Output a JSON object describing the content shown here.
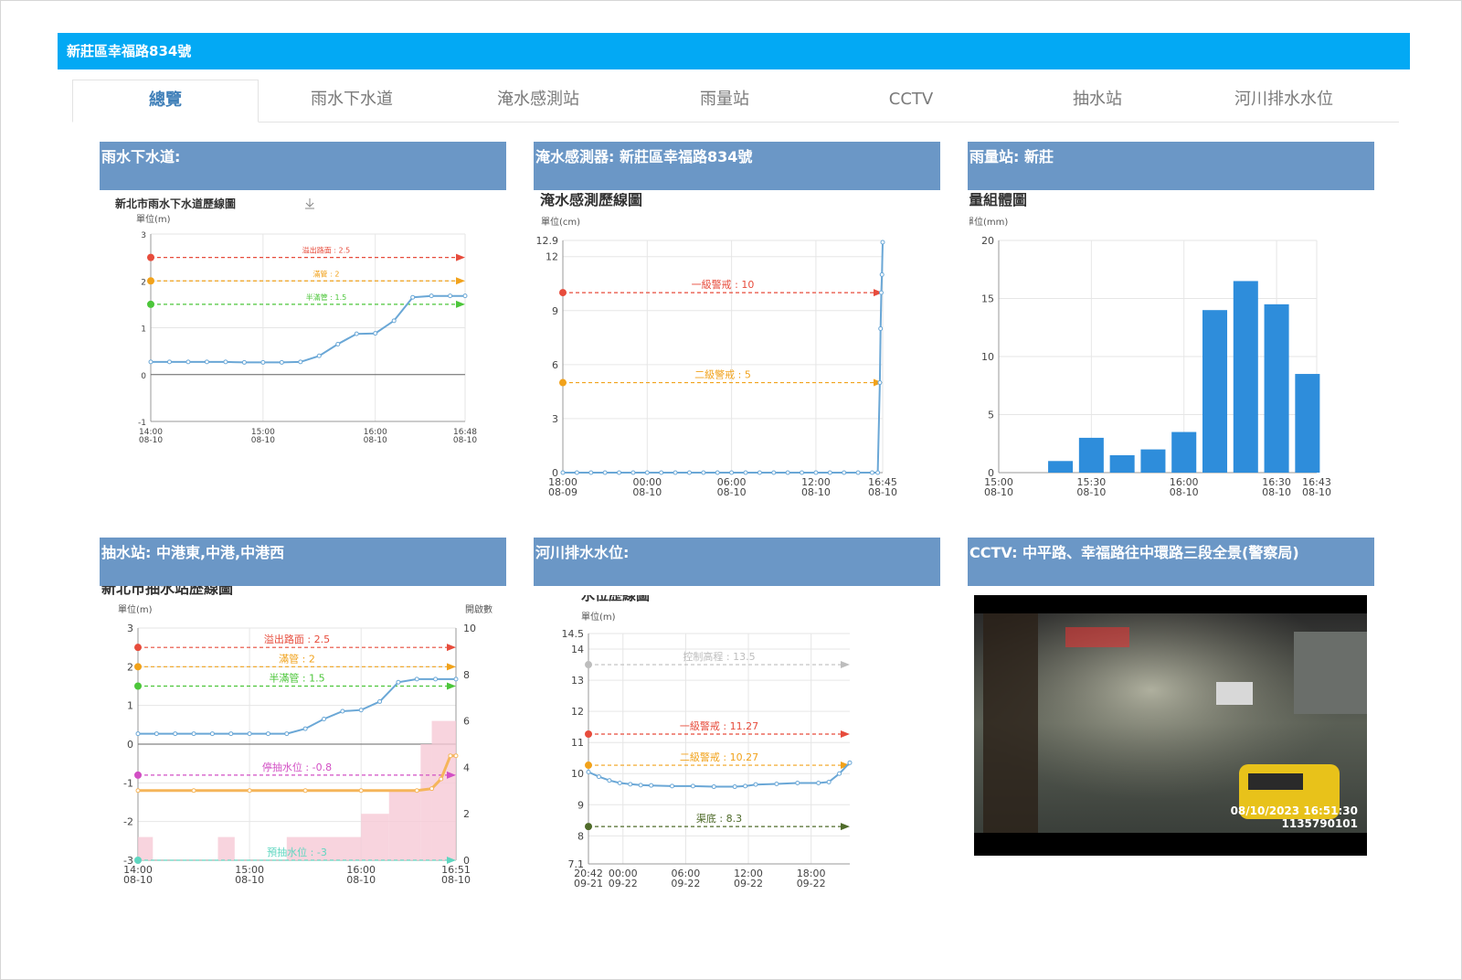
{
  "window_title": "新莊區幸福路834號",
  "tabs": [
    {
      "label": "總覽",
      "active": true
    },
    {
      "label": "雨水下水道"
    },
    {
      "label": "淹水感測站"
    },
    {
      "label": "雨量站"
    },
    {
      "label": "CCTV"
    },
    {
      "label": "抽水站"
    },
    {
      "label": "河川排水水位"
    }
  ],
  "panels": {
    "sewer": {
      "header": "雨水下水道:"
    },
    "flood": {
      "header": "淹水感測器: 新莊區幸福路834號"
    },
    "rain": {
      "header": "雨量站: 新莊"
    },
    "pump": {
      "header": "抽水站: 中港東,中港,中港西"
    },
    "river": {
      "header": "河川排水水位:"
    },
    "cctv": {
      "header": "CCTV: 中平路、幸福路往中環路三段全景(警察局)",
      "overlay_date": "08/10/2023 16:51:30",
      "overlay_id": "1135790101"
    }
  },
  "colors": {
    "accent": "#03a9f4",
    "panel_header": "#6b97c6",
    "line": "#6aa7d6",
    "bar": "#2e8ddb",
    "red": "#e74c3c",
    "orange": "#f1a21b",
    "green": "#4cc63a",
    "magenta": "#d24fc4",
    "teal": "#5fd6c0",
    "gray": "#bdbdbd",
    "olive": "#4f6b2a"
  },
  "chart_data": [
    {
      "id": "sewer",
      "type": "line",
      "title": "新北市雨水下水道歷線圖",
      "unit": "單位(m)",
      "download_icon": "download-icon",
      "ylim": [
        -1,
        3
      ],
      "yticks": [
        -1,
        0,
        1,
        2,
        3
      ],
      "xticks": [
        {
          "t": 0,
          "label": [
            "14:00",
            "08-10"
          ]
        },
        {
          "t": 60,
          "label": [
            "15:00",
            "08-10"
          ]
        },
        {
          "t": 120,
          "label": [
            "16:00",
            "08-10"
          ]
        },
        {
          "t": 168,
          "label": [
            "16:48",
            "08-10"
          ]
        }
      ],
      "x_range": [
        0,
        168
      ],
      "thresholds": [
        {
          "label": "溢出路面 : 2.5",
          "value": 2.5,
          "color": "#e74c3c"
        },
        {
          "label": "滿管 : 2",
          "value": 2,
          "color": "#f1a21b"
        },
        {
          "label": "半滿管 : 1.5",
          "value": 1.5,
          "color": "#4cc63a"
        }
      ],
      "series": [
        {
          "points": [
            [
              0,
              0.27
            ],
            [
              10,
              0.27
            ],
            [
              20,
              0.27
            ],
            [
              30,
              0.27
            ],
            [
              40,
              0.27
            ],
            [
              50,
              0.26
            ],
            [
              60,
              0.26
            ],
            [
              70,
              0.26
            ],
            [
              80,
              0.27
            ],
            [
              90,
              0.4
            ],
            [
              100,
              0.65
            ],
            [
              110,
              0.87
            ],
            [
              120,
              0.88
            ],
            [
              130,
              1.15
            ],
            [
              140,
              1.65
            ],
            [
              150,
              1.68
            ],
            [
              160,
              1.68
            ],
            [
              168,
              1.68
            ]
          ]
        }
      ]
    },
    {
      "id": "flood",
      "type": "line",
      "title": "淹水感測歷線圖",
      "unit": "單位(cm)",
      "ylim": [
        0,
        12.9
      ],
      "yticks": [
        0,
        3,
        6,
        9,
        12,
        12.9
      ],
      "xticks": [
        {
          "t": 0,
          "label": [
            "18:00",
            "08-09"
          ]
        },
        {
          "t": 6,
          "label": [
            "00:00",
            "08-10"
          ]
        },
        {
          "t": 12,
          "label": [
            "06:00",
            "08-10"
          ]
        },
        {
          "t": 18,
          "label": [
            "12:00",
            "08-10"
          ]
        },
        {
          "t": 22.75,
          "label": [
            "16:45",
            "08-10"
          ]
        }
      ],
      "x_range": [
        0,
        22.75
      ],
      "thresholds": [
        {
          "label": "一級警戒 : 10",
          "value": 10,
          "color": "#e74c3c"
        },
        {
          "label": "二級警戒 : 5",
          "value": 5,
          "color": "#f1a21b"
        }
      ],
      "series": [
        {
          "points": [
            [
              0,
              0
            ],
            [
              1,
              0
            ],
            [
              2,
              0
            ],
            [
              3,
              0
            ],
            [
              4,
              0
            ],
            [
              5,
              0
            ],
            [
              6,
              0
            ],
            [
              7,
              0
            ],
            [
              8,
              0
            ],
            [
              9,
              0
            ],
            [
              10,
              0
            ],
            [
              11,
              0
            ],
            [
              12,
              0
            ],
            [
              13,
              0
            ],
            [
              14,
              0
            ],
            [
              15,
              0
            ],
            [
              16,
              0
            ],
            [
              17,
              0
            ],
            [
              18,
              0
            ],
            [
              19,
              0
            ],
            [
              20,
              0
            ],
            [
              21,
              0
            ],
            [
              22,
              0
            ],
            [
              22.4,
              0
            ],
            [
              22.55,
              5
            ],
            [
              22.6,
              8
            ],
            [
              22.65,
              10
            ],
            [
              22.7,
              11
            ],
            [
              22.75,
              12.8
            ]
          ]
        }
      ]
    },
    {
      "id": "rain",
      "type": "bar",
      "title": "雨量組體圖",
      "unit": "單位(mm)",
      "ylim": [
        0,
        20
      ],
      "yticks": [
        0,
        5,
        10,
        15,
        20
      ],
      "xticks": [
        {
          "t": 0,
          "label": [
            "15:00",
            "08-10"
          ]
        },
        {
          "t": 30,
          "label": [
            "15:30",
            "08-10"
          ]
        },
        {
          "t": 60,
          "label": [
            "16:00",
            "08-10"
          ]
        },
        {
          "t": 90,
          "label": [
            "16:30",
            "08-10"
          ]
        },
        {
          "t": 103,
          "label": [
            "16:43",
            "08-10"
          ]
        }
      ],
      "x_range": [
        0,
        103
      ],
      "bars": [
        {
          "t": 20,
          "value": 1
        },
        {
          "t": 30,
          "value": 3
        },
        {
          "t": 40,
          "value": 1.5
        },
        {
          "t": 50,
          "value": 2
        },
        {
          "t": 60,
          "value": 3.5
        },
        {
          "t": 70,
          "value": 14
        },
        {
          "t": 80,
          "value": 16.5
        },
        {
          "t": 90,
          "value": 14.5
        },
        {
          "t": 100,
          "value": 8.5
        }
      ]
    },
    {
      "id": "pump",
      "type": "line",
      "title": "新北市抽水站歷線圖",
      "unit": "單位(m)",
      "unit_right": "開啟數",
      "ylim": [
        -3,
        3
      ],
      "yticks": [
        -3,
        -2,
        -1,
        0,
        1,
        2,
        3
      ],
      "y2lim": [
        0,
        10
      ],
      "y2ticks": [
        0,
        2,
        4,
        6,
        8,
        10
      ],
      "xticks": [
        {
          "t": 0,
          "label": [
            "14:00",
            "08-10"
          ]
        },
        {
          "t": 60,
          "label": [
            "15:00",
            "08-10"
          ]
        },
        {
          "t": 120,
          "label": [
            "16:00",
            "08-10"
          ]
        },
        {
          "t": 171,
          "label": [
            "16:51",
            "08-10"
          ]
        }
      ],
      "x_range": [
        0,
        171
      ],
      "thresholds": [
        {
          "label": "溢出路面 : 2.5",
          "value": 2.5,
          "color": "#e74c3c"
        },
        {
          "label": "滿管 : 2",
          "value": 2,
          "color": "#f1a21b"
        },
        {
          "label": "半滿管 : 1.5",
          "value": 1.5,
          "color": "#4cc63a"
        },
        {
          "label": "停抽水位 : -0.8",
          "value": -0.8,
          "color": "#d24fc4"
        },
        {
          "label": "預抽水位 : -3",
          "value": -3,
          "color": "#5fd6c0"
        }
      ],
      "series": [
        {
          "points": [
            [
              0,
              0.27
            ],
            [
              10,
              0.27
            ],
            [
              20,
              0.27
            ],
            [
              30,
              0.27
            ],
            [
              40,
              0.27
            ],
            [
              50,
              0.27
            ],
            [
              60,
              0.27
            ],
            [
              70,
              0.27
            ],
            [
              80,
              0.27
            ],
            [
              90,
              0.4
            ],
            [
              100,
              0.65
            ],
            [
              110,
              0.85
            ],
            [
              120,
              0.88
            ],
            [
              130,
              1.1
            ],
            [
              140,
              1.6
            ],
            [
              150,
              1.68
            ],
            [
              160,
              1.68
            ],
            [
              171,
              1.68
            ]
          ]
        },
        {
          "points": [
            [
              0,
              -1.2
            ],
            [
              30,
              -1.2
            ],
            [
              60,
              -1.2
            ],
            [
              90,
              -1.2
            ],
            [
              120,
              -1.2
            ],
            [
              150,
              -1.2
            ],
            [
              158,
              -1.15
            ],
            [
              163,
              -0.9
            ],
            [
              168,
              -0.3
            ],
            [
              171,
              -0.3
            ]
          ]
        }
      ],
      "open_counts": [
        {
          "t0": 0,
          "t1": 8,
          "value": 1
        },
        {
          "t0": 43,
          "t1": 52,
          "value": 1
        },
        {
          "t0": 80,
          "t1": 120,
          "value": 1
        },
        {
          "t0": 120,
          "t1": 135,
          "value": 2
        },
        {
          "t0": 135,
          "t1": 152,
          "value": 3
        },
        {
          "t0": 152,
          "t1": 158,
          "value": 5
        },
        {
          "t0": 158,
          "t1": 171,
          "value": 6
        }
      ]
    },
    {
      "id": "river",
      "type": "line",
      "title": "水位歷線圖",
      "unit": "單位(m)",
      "ylim": [
        7.1,
        14.5
      ],
      "yticks": [
        7.1,
        8,
        9,
        10,
        11,
        12,
        13,
        14,
        14.5
      ],
      "xticks": [
        {
          "t": 0,
          "label": [
            "20:42",
            "09-21"
          ]
        },
        {
          "t": 3.3,
          "label": [
            "00:00",
            "09-22"
          ]
        },
        {
          "t": 9.3,
          "label": [
            "06:00",
            "09-22"
          ]
        },
        {
          "t": 15.3,
          "label": [
            "12:00",
            "09-22"
          ]
        },
        {
          "t": 21.3,
          "label": [
            "18:00",
            "09-22"
          ]
        }
      ],
      "x_range": [
        0,
        25
      ],
      "thresholds": [
        {
          "label": "控制高程 : 13.5",
          "value": 13.5,
          "color": "#bdbdbd"
        },
        {
          "label": "一級警戒 : 11.27",
          "value": 11.27,
          "color": "#e74c3c"
        },
        {
          "label": "二級警戒 : 10.27",
          "value": 10.27,
          "color": "#f1a21b"
        },
        {
          "label": "渠底 : 8.3",
          "value": 8.3,
          "color": "#4f6b2a"
        }
      ],
      "series": [
        {
          "points": [
            [
              0,
              10.05
            ],
            [
              1,
              9.9
            ],
            [
              2,
              9.78
            ],
            [
              3,
              9.7
            ],
            [
              4,
              9.66
            ],
            [
              5,
              9.63
            ],
            [
              6,
              9.62
            ],
            [
              8,
              9.6
            ],
            [
              10,
              9.6
            ],
            [
              12,
              9.58
            ],
            [
              14,
              9.58
            ],
            [
              15,
              9.6
            ],
            [
              16,
              9.65
            ],
            [
              18,
              9.67
            ],
            [
              20,
              9.7
            ],
            [
              22,
              9.7
            ],
            [
              23,
              9.73
            ],
            [
              24,
              10
            ],
            [
              25,
              10.35
            ]
          ]
        }
      ]
    }
  ]
}
